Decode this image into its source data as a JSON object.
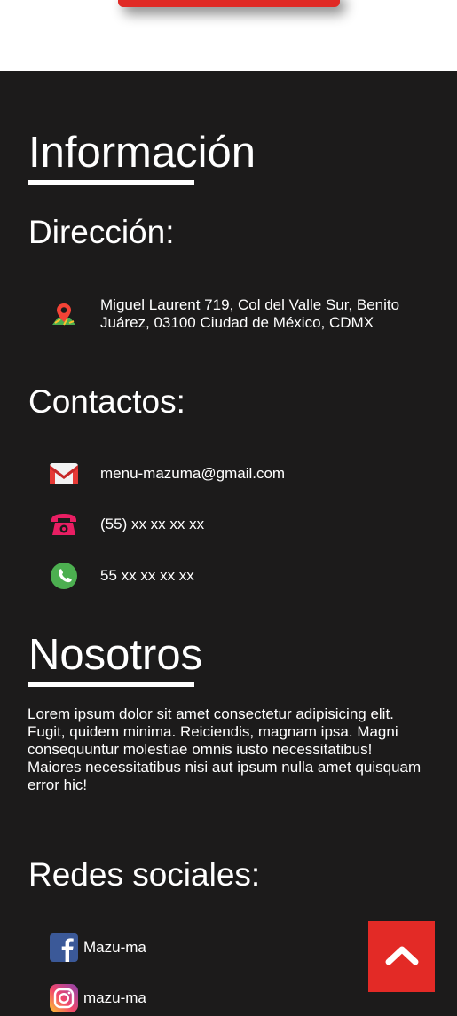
{
  "sections": {
    "informacion_title": "Información",
    "direccion_title": "Dirección:",
    "address": "Miguel Laurent 719, Col del Valle Sur, Benito Juárez, 03100 Ciudad de México, CDMX",
    "contactos_title": "Contactos:",
    "contacts": {
      "email": "menu-mazuma@gmail.com",
      "phone": "(55) xx xx xx xx",
      "whatsapp": "55 xx xx xx xx"
    },
    "nosotros_title": "Nosotros",
    "nosotros_text": "Lorem ipsum dolor sit amet consectetur adipisicing elit. Fugit, quidem minima. Reiciendis, magnam ipsa. Magni consequuntur molestiae omnis iusto necessitatibus! Maiores necessitatibus nisi aut ipsum nulla amet quisquam error hic!",
    "redes_title": "Redes sociales:",
    "social": {
      "facebook": "Mazu-ma",
      "instagram": "mazu-ma"
    }
  },
  "icons": {
    "address": "map-pin-icon",
    "email": "gmail-icon",
    "phone": "telephone-icon",
    "whatsapp": "whatsapp-icon",
    "facebook": "facebook-icon",
    "instagram": "instagram-icon",
    "scroll_top": "chevron-up-icon"
  },
  "colors": {
    "background": "#1c1b1b",
    "accent_red": "#e32a26",
    "text": "#ffffff"
  }
}
